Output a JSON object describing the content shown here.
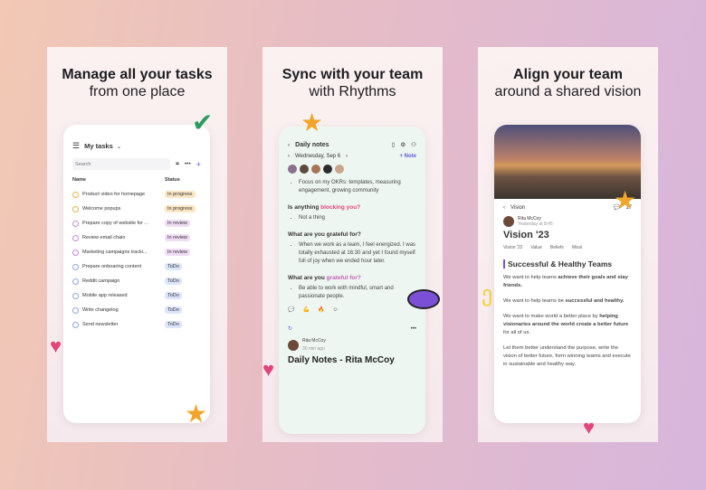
{
  "panels": [
    {
      "title_line1": "Manage all your tasks",
      "title_line2": "from one place"
    },
    {
      "title_line1": "Sync with your team",
      "title_line2": "with Rhythms"
    },
    {
      "title_line1": "Align your team",
      "title_line2": "around a shared vision"
    }
  ],
  "tasks": {
    "header": "My tasks",
    "search_placeholder": "Search",
    "col_name": "Name",
    "col_status": "Status",
    "rows": [
      {
        "name": "Product video for homepage",
        "status": "In progress",
        "kind": "progress"
      },
      {
        "name": "Welcome popups",
        "status": "In progress",
        "kind": "progress"
      },
      {
        "name": "Prepare copy of website for ...",
        "status": "In review",
        "kind": "review"
      },
      {
        "name": "Review email chain",
        "status": "In review",
        "kind": "review"
      },
      {
        "name": "Marketing campaigns tracki...",
        "status": "In review",
        "kind": "review"
      },
      {
        "name": "Prepare onboaring content",
        "status": "ToDo",
        "kind": "todo"
      },
      {
        "name": "Reddit campaign",
        "status": "ToDo",
        "kind": "todo"
      },
      {
        "name": "Mobile app released",
        "status": "ToDo",
        "kind": "todo"
      },
      {
        "name": "Write changelog",
        "status": "ToDo",
        "kind": "todo"
      },
      {
        "name": "Send newsletter",
        "status": "ToDo",
        "kind": "todo"
      }
    ]
  },
  "notes": {
    "header": "Daily notes",
    "date": "Wednesday, Sep 6",
    "add_note": "+ Note",
    "bullet1": "Focus on my OKRs: templates, measuring engagement, growing community",
    "q1_pre": "Is anything ",
    "q1_hl": "blocking you?",
    "a1": "Not a thing",
    "q2": "What are you grateful for?",
    "a2": "When we work as a team, I feel energized. I was totally exhausted at 16:30 and yet I found myself full of joy when we ended hour later.",
    "q3_pre": "What are you ",
    "q3_hl": "grateful for?",
    "a3": "Be able to work with mindful, smart and passionate people.",
    "author": "Rita McCoy",
    "time": "30 min ago",
    "footer_title": "Daily Notes - Rita McCoy"
  },
  "vision": {
    "breadcrumb": "Vision",
    "comments": "17",
    "author": "Rita McCoy",
    "time": "Yesterday at 8:45",
    "title": "Vision '23",
    "tabs": [
      "Vision '22",
      "Value",
      "Beliefs",
      "Missi"
    ],
    "heading": "Successful & Healthy Teams",
    "p1_pre": "We want to help teams ",
    "p1_b": "achieve their goals and stay friends.",
    "p2_pre": "We want to help teams be ",
    "p2_b": "successful and healthy.",
    "p3_pre": "We want to make world a better place by ",
    "p3_b": "helping visionaries around the world create a better future",
    "p3_post": " for all of us.",
    "p4": "Let them better understand the purpose, write the vision of better future, form winning teams and execute in sustainable and healthy way."
  },
  "colors": {
    "progress": "#fbe6c4",
    "review": "#efdcf5",
    "todo": "#dbe6fb",
    "accent": "#5b5bd6",
    "pink": "#e0457b"
  }
}
